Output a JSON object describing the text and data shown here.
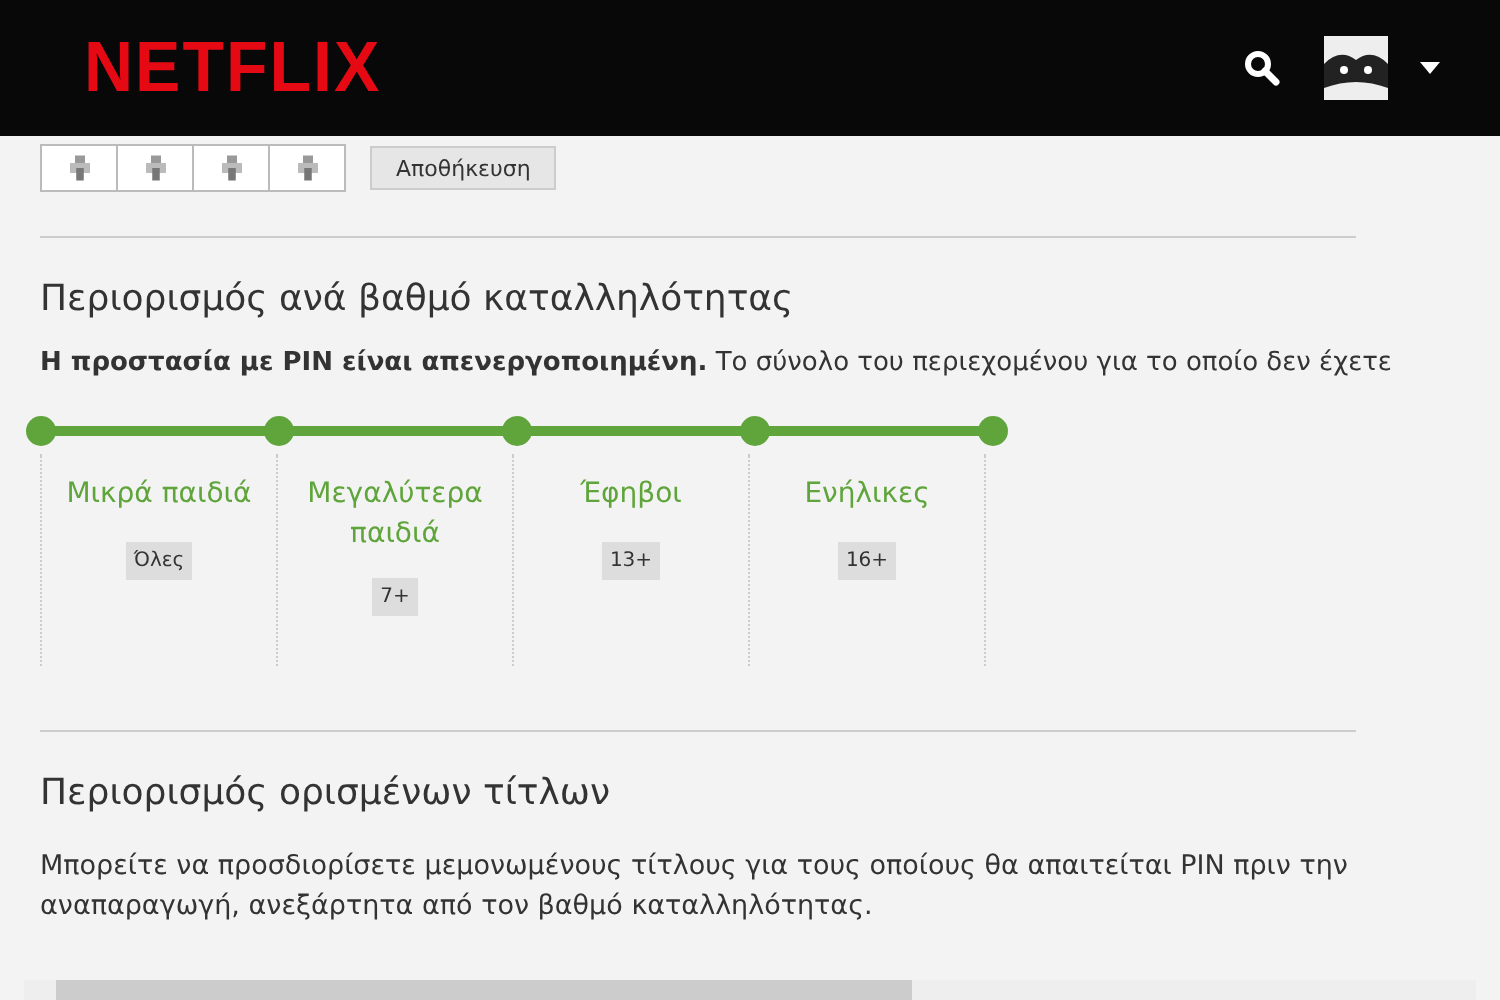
{
  "header": {
    "logo": "NETFLIX"
  },
  "pin": {
    "save_button": "Αποθήκευση"
  },
  "maturity": {
    "title": "Περιορισμός ανά βαθμό καταλληλότητας",
    "status": "**Η προστασία με PIN είναι απενεργοποιημένη.** Το σύνολο του περιεχομένου για το οποίο δεν έχετε",
    "level": 1,
    "tiers": [
      {
        "label": "Μικρά παιδιά",
        "badge": "Όλες"
      },
      {
        "label": "Μεγαλύτερα παιδιά",
        "badge": "7+"
      },
      {
        "label": "Έφηβοι",
        "badge": "13+"
      },
      {
        "label": "Ενήλικες",
        "badge": "16+"
      }
    ]
  },
  "titles": {
    "title": "Περιορισμός ορισμένων τίτλων",
    "text": "Μπορείτε να προσδιορίσετε μεμονωμένους τίτλους για τους οποίους θα απαιτείται PIN πριν την αναπαραγωγή, ανεξάρτητα από τον βαθμό καταλληλότητας."
  }
}
